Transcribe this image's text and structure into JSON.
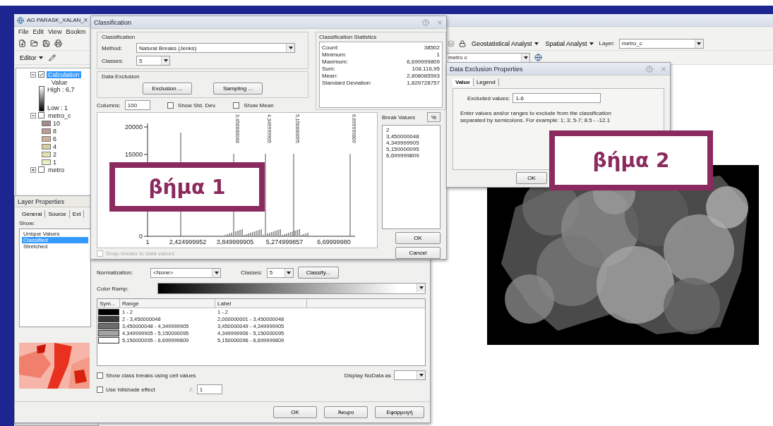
{
  "main_window": {
    "title": "AG PARASK_XALAN_X",
    "menu": [
      "File",
      "Edit",
      "View",
      "Bookm"
    ],
    "editor_menu": "Editor",
    "geostatistical_menu": "Geostatistical Analyst",
    "spatial_menu": "Spatial Analyst",
    "layer_label": "Layer:",
    "layer_value": "metro_c",
    "target_layer": "metro c"
  },
  "toc": {
    "layers": [
      {
        "name": "Calculation",
        "kind": "raster",
        "checked": true,
        "selected": true,
        "expanded": true,
        "legend_title": "Value",
        "high": "High : 6,7",
        "low": "Low : 1"
      },
      {
        "name": "metro_c",
        "kind": "classes",
        "checked": false,
        "selected": false,
        "expanded": true,
        "classes": [
          {
            "label": "10",
            "color": "#a38c88"
          },
          {
            "label": "8",
            "color": "#b89f93"
          },
          {
            "label": "6",
            "color": "#cab49b"
          },
          {
            "label": "4",
            "color": "#d8cea4"
          },
          {
            "label": "2",
            "color": "#e3e2ae"
          },
          {
            "label": "1",
            "color": "#ebedc3"
          }
        ]
      },
      {
        "name": "metro",
        "checked": false,
        "selected": false,
        "expanded": false
      }
    ]
  },
  "classification": {
    "title": "Classification",
    "group_label": "Classification",
    "method_label": "Method:",
    "method": "Natural Breaks (Jenks)",
    "classes_label": "Classes:",
    "classes": "5",
    "exclusion_group": "Data Exclusion",
    "exclusion_button": "Exclusion ...",
    "sampling_button": "Sampling ...",
    "stats_title": "Classification Statistics",
    "stats": [
      {
        "label": "Count:",
        "value": "38502"
      },
      {
        "label": "Minimum:",
        "value": "1"
      },
      {
        "label": "Maximum:",
        "value": "6,699999809"
      },
      {
        "label": "Sum:",
        "value": "108.116,95"
      },
      {
        "label": "Mean:",
        "value": "2,808085593"
      },
      {
        "label": "Standard Deviation:",
        "value": "1,829728757"
      }
    ],
    "columns_label": "Columns:",
    "columns": "100",
    "show_std_dev": {
      "label": "Show Std. Dev.",
      "checked": false
    },
    "show_mean": {
      "label": "Show Mean",
      "checked": false
    },
    "histogram": {
      "y_ticks": [
        "20000",
        "15000",
        "0"
      ],
      "x_ticks": [
        "1",
        "2,424999952",
        "3,849999905",
        "5,274999857",
        "6,69999980"
      ],
      "break_labels": [
        "3,450000048",
        "4,349999905",
        "5,150000095",
        "6,699999809"
      ]
    },
    "break_values_title": "Break Values",
    "percent_button": "%",
    "break_values": [
      "2",
      "3,450000048",
      "4,349999905",
      "5,150000095",
      "6,699999809"
    ],
    "snap": {
      "label": "Snap breaks to data values",
      "checked": false,
      "disabled": true
    },
    "ok": "OK",
    "cancel": "Cancel"
  },
  "data_exclusion": {
    "title": "Data Exclusion Properties",
    "tabs": [
      {
        "label": "Value",
        "selected": true
      },
      {
        "label": "Legend",
        "selected": false
      }
    ],
    "excluded_label": "Excluded values:",
    "excluded_value": "1-6",
    "help": "Enter values and/or ranges to exclude from the classification separated by semicolons. For example: 1; 3; 5-7; 8.5 - -12.1",
    "ok": "OK"
  },
  "layer_properties": {
    "title": "Layer Properties",
    "tabs": [
      {
        "label": "General",
        "selected": false
      },
      {
        "label": "Source",
        "selected": false
      },
      {
        "label": "Ext",
        "selected": false
      }
    ],
    "show_label": "Show:",
    "renderers": [
      {
        "label": "Unique Values",
        "selected": false
      },
      {
        "label": "Classified",
        "selected": true
      },
      {
        "label": "Stretched",
        "selected": false
      }
    ],
    "normalization_label": "Normalization:",
    "normalization": "<None>",
    "classes_label": "Classes:",
    "classes": "5",
    "classify_button": "Classify...",
    "color_ramp_label": "Color Ramp:",
    "table": {
      "columns": [
        "Sym...",
        "Range",
        "Label"
      ],
      "rows": [
        {
          "color": "#000000",
          "range": "1 - 2",
          "label": "1 - 2"
        },
        {
          "color": "#3a3a3a",
          "range": "2 - 3,450000048",
          "label": "2,000000001 - 3,450000048"
        },
        {
          "color": "#6c6c6c",
          "range": "3,450000048 - 4,349999905",
          "label": "3,450000049 - 4,349999905"
        },
        {
          "color": "#a3a3a3",
          "range": "4,349999905 - 5,150000095",
          "label": "4,349999906 - 5,150000095"
        },
        {
          "color": "#ffffff",
          "range": "5,150000095 - 6,699999809",
          "label": "5,150000096 - 6,699999809"
        }
      ]
    },
    "class_breaks": {
      "label": "Show class breaks using cell values",
      "checked": false
    },
    "hillshade": {
      "label": "Use hillshade effect",
      "checked": false
    },
    "z_label": "Z:",
    "z_value": "1",
    "nodata_label": "Display NoData as",
    "buttons": [
      "OK",
      "Άκυρο",
      "Εφαρμογή"
    ]
  },
  "callouts": [
    {
      "text": "βήμα 1"
    },
    {
      "text": "βήμα 2"
    }
  ]
}
